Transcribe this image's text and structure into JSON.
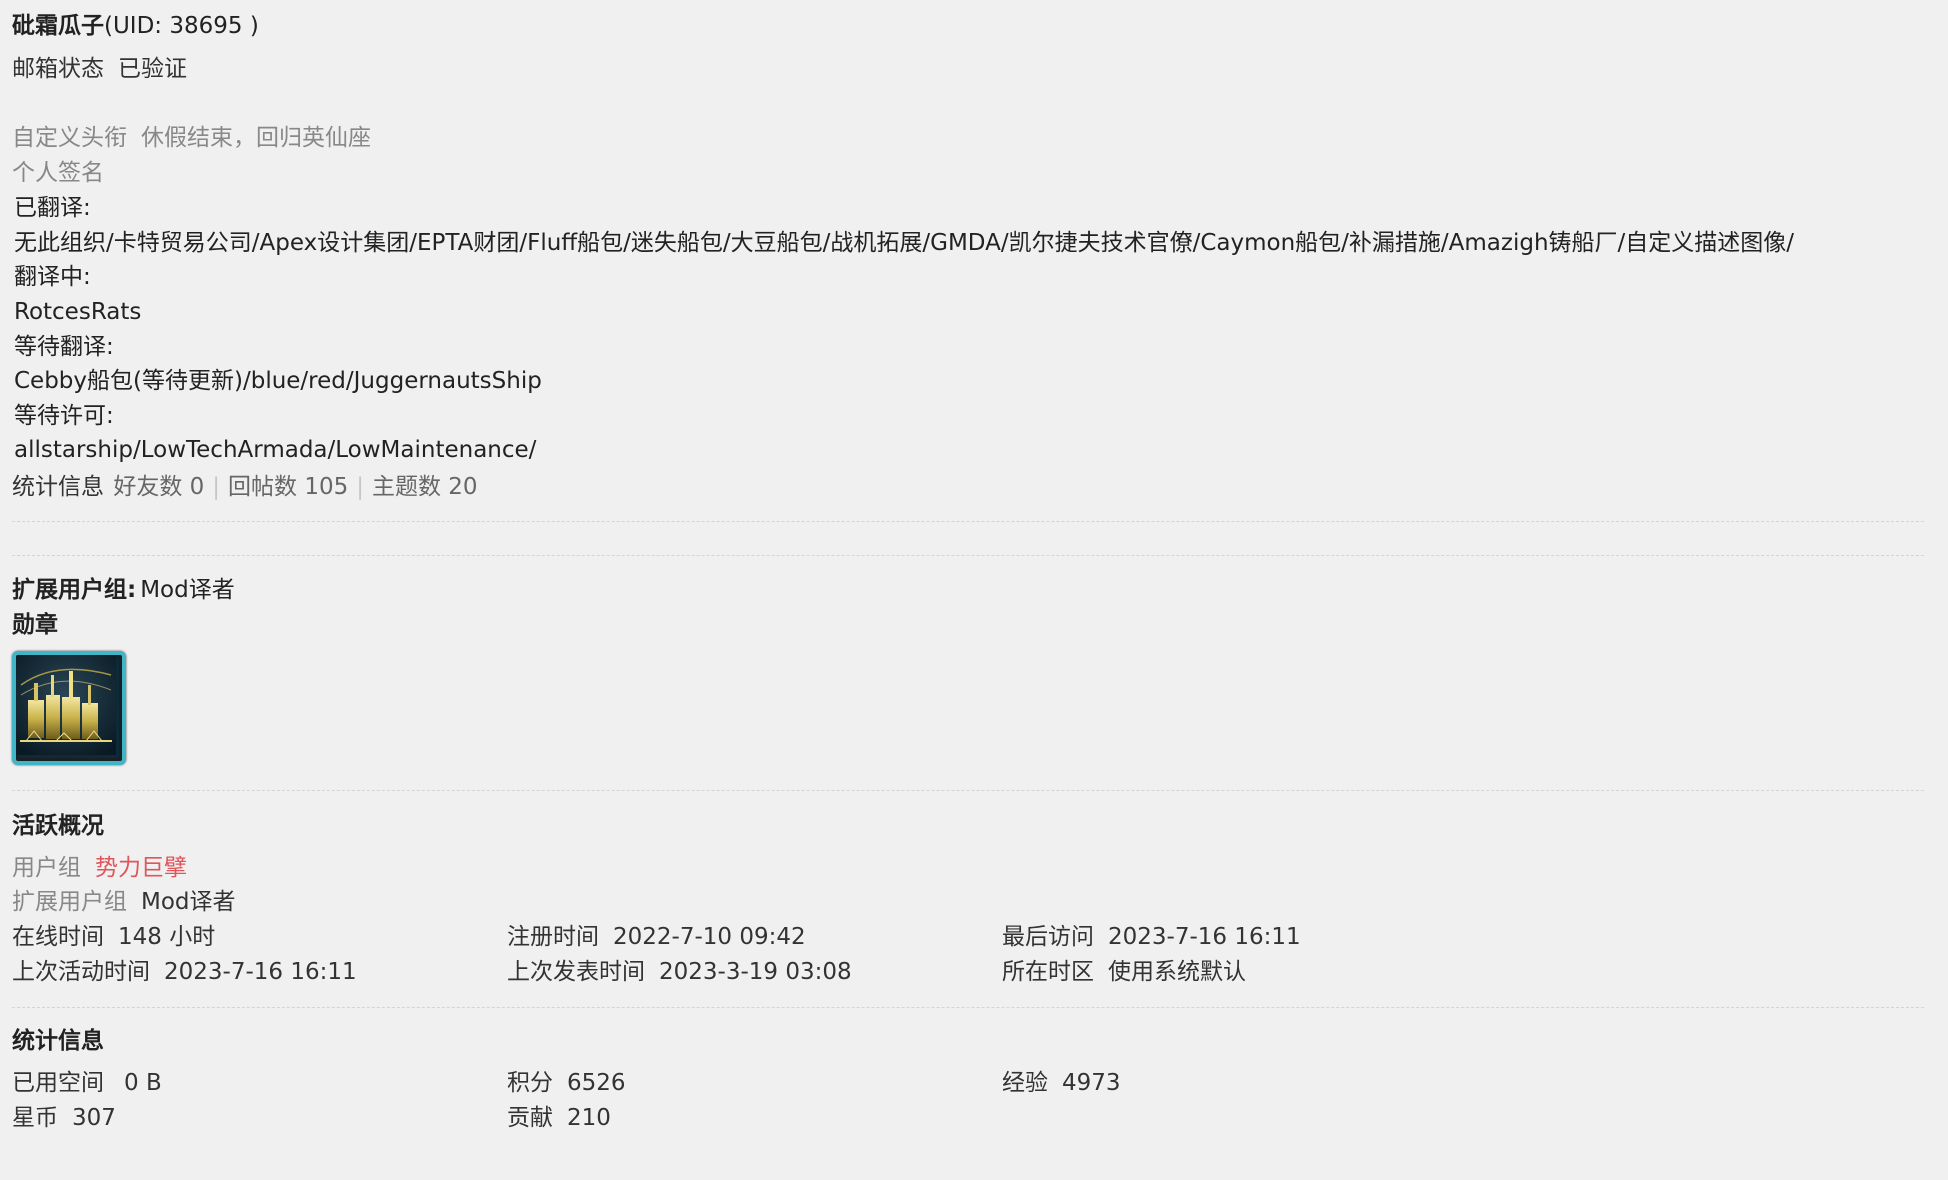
{
  "profile": {
    "username": "砒霜瓜子",
    "uid_text": "(UID: 38695 )",
    "email_label": "邮箱状态",
    "email_value": "已验证",
    "title_label": "自定义头衔",
    "title_value": "休假结束，回归英仙座",
    "signature_label": "个人签名"
  },
  "signature": {
    "translated_label": "已翻译:",
    "translated": "无此组织/卡特贸易公司/Apex设计集团/EPTA财团/Fluff船包/迷失船包/大豆船包/战机拓展/GMDA/凯尔捷夫技术官僚/Caymon船包/补漏措施/Amazigh铸船厂/自定义描述图像/",
    "translating_label": "翻译中:",
    "translating": "RotcesRats",
    "pending_label": "等待翻译:",
    "pending": "Cebby船包(等待更新)/blue/red/JuggernautsShip",
    "permission_label": "等待许可:",
    "permission": "allstarship/LowTechArmada/LowMaintenance/"
  },
  "stats_line": {
    "label": "统计信息",
    "friends": "好友数 0",
    "replies": "回帖数 105",
    "threads": "主题数 20",
    "separator": "|"
  },
  "extended_group": {
    "label": "扩展用户组:",
    "value": "Mod译者"
  },
  "medals": {
    "label": "勋章",
    "icon": "medal-station-icon"
  },
  "activity": {
    "heading": "活跃概况",
    "group_label": "用户组",
    "group_value": "势力巨擘",
    "group_color": "#e0545a",
    "ext_group_label": "扩展用户组",
    "ext_group_value": "Mod译者",
    "online_label": "在线时间",
    "online_value": "148 小时",
    "register_label": "注册时间",
    "register_value": "2022-7-10 09:42",
    "last_visit_label": "最后访问",
    "last_visit_value": "2023-7-16 16:11",
    "last_active_label": "上次活动时间",
    "last_active_value": "2023-7-16 16:11",
    "last_post_label": "上次发表时间",
    "last_post_value": "2023-3-19 03:08",
    "timezone_label": "所在时区",
    "timezone_value": "使用系统默认"
  },
  "statistics": {
    "heading": "统计信息",
    "space_label": "已用空间",
    "space_value": "0 B",
    "points_label": "积分",
    "points_value": "6526",
    "exp_label": "经验",
    "exp_value": "4973",
    "coins_label": "星币",
    "coins_value": "307",
    "contrib_label": "贡献",
    "contrib_value": "210"
  }
}
